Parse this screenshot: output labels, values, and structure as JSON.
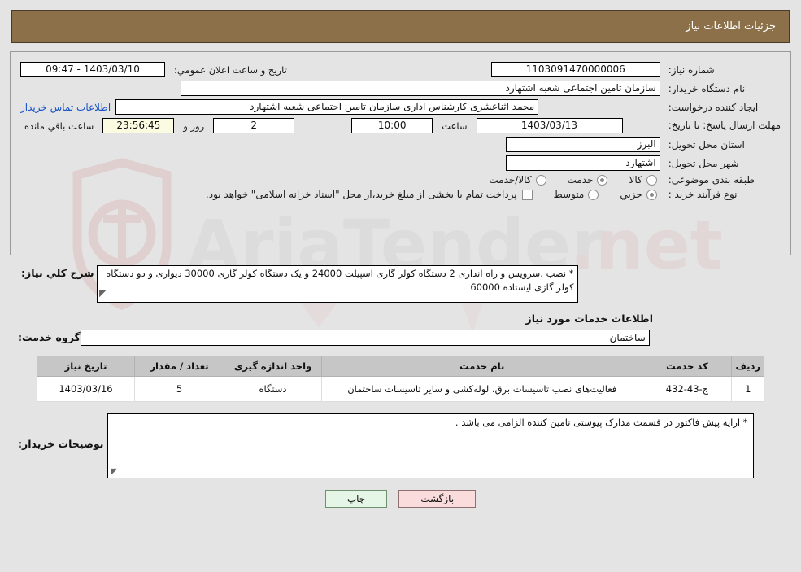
{
  "header": {
    "title": "جزئیات اطلاعات نیاز",
    "bg_color": "#8c7049"
  },
  "form": {
    "need_number_label": "شماره نیاز:",
    "need_number_value": "1103091470000006",
    "public_announce_label": "تاریخ و ساعت اعلان عمومي:",
    "public_announce_value": "1403/03/10 - 09:47",
    "buyer_org_label": "نام دستگاه خریدار:",
    "buyer_org_value": "سازمان تامین اجتماعی شعبه اشتهارد",
    "creator_label": "ایجاد کننده درخواست:",
    "creator_value": "محمد اثناعشری کارشناس اداری سازمان تامین اجتماعی شعبه اشتهارد",
    "contact_link": "اطلاعات تماس خریدار",
    "deadline_label": "مهلت ارسال پاسخ: تا تاریخ:",
    "deadline_date": "1403/03/13",
    "hour_label": "ساعت",
    "deadline_hour": "10:00",
    "days_value": "2",
    "days_label": "روز و",
    "countdown_value": "23:56:45",
    "remaining_label": "ساعت باقي مانده",
    "province_label": "استان محل تحویل:",
    "province_value": "البرز",
    "city_label": "شهر محل تحویل:",
    "city_value": "اشتهارد",
    "category_label": "طبقه بندی موضوعی:",
    "category_options": [
      {
        "label": "کالا",
        "selected": false
      },
      {
        "label": "خدمت",
        "selected": true
      },
      {
        "label": "کالا/خدمت",
        "selected": false
      }
    ],
    "process_label": "نوع فرآیند خرید :",
    "process_options": [
      {
        "label": "جزیي",
        "selected": true
      },
      {
        "label": "متوسط",
        "selected": false
      }
    ],
    "treasury_checkbox_label": "پرداخت تمام یا بخشی از مبلغ خرید،از محل \"اسناد خزانه اسلامی\" خواهد بود.",
    "treasury_checked": false
  },
  "description": {
    "label": "شرح کلي نیاز:",
    "value": "* نصب ،سرویس و راه اندازی 2 دستگاه کولر گازی اسپیلت 24000 و یک دستگاه کولر گازی 30000 دیواری و دو دستگاه کولر گازی ایستاده 60000"
  },
  "services_section": {
    "title": "اطلاعات خدمات مورد نیاز",
    "group_label": "گروه خدمت:",
    "group_value": "ساختمان"
  },
  "table": {
    "columns": [
      "ردیف",
      "کد خدمت",
      "نام خدمت",
      "واحد اندازه گیری",
      "تعداد / مقدار",
      "تاریخ نیاز"
    ],
    "rows": [
      {
        "row": "1",
        "code": "ج-43-432",
        "name": "فعالیت‌های نصب تاسیسات برق، لوله‌کشی و سایر تاسیسات ساختمان",
        "unit": "دستگاه",
        "quantity": "5",
        "date": "1403/03/16"
      }
    ]
  },
  "buyer_notes": {
    "label": "توضیحات خریدار:",
    "value": "* ارایه پیش فاکتور در قسمت مدارک پیوستی تامین کننده الزامی می باشد ."
  },
  "footer": {
    "print_label": "چاپ",
    "back_label": "بازگشت"
  },
  "watermark": {
    "text": "AriaTender.net"
  }
}
